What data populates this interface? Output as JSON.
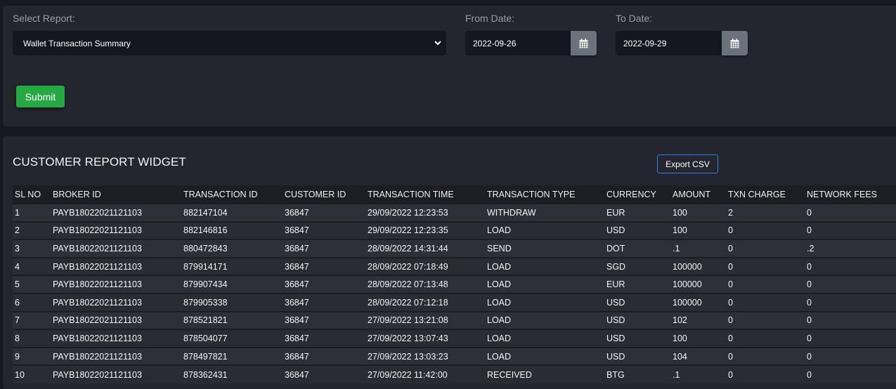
{
  "filters": {
    "select_report_label": "Select Report:",
    "select_report_value": "Wallet Transaction Summary",
    "from_date_label": "From Date:",
    "from_date_value": "2022-09-26",
    "to_date_label": "To Date:",
    "to_date_value": "2022-09-29",
    "submit_label": "Submit"
  },
  "widget": {
    "title": "CUSTOMER REPORT WIDGET",
    "export_label": "Export CSV",
    "columns": [
      "SL NO",
      "BROKER ID",
      "TRANSACTION ID",
      "CUSTOMER ID",
      "TRANSACTION TIME",
      "TRANSACTION TYPE",
      "CURRENCY",
      "AMOUNT",
      "TXN CHARGE",
      "NETWORK FEES"
    ],
    "rows": [
      [
        "1",
        "PAYB18022021121103",
        "882147104",
        "36847",
        "29/09/2022 12:23:53",
        "WITHDRAW",
        "EUR",
        "100",
        "2",
        "0"
      ],
      [
        "2",
        "PAYB18022021121103",
        "882146816",
        "36847",
        "29/09/2022 12:23:35",
        "LOAD",
        "USD",
        "100",
        "0",
        "0"
      ],
      [
        "3",
        "PAYB18022021121103",
        "880472843",
        "36847",
        "28/09/2022 14:31:44",
        "SEND",
        "DOT",
        ".1",
        "0",
        ".2"
      ],
      [
        "4",
        "PAYB18022021121103",
        "879914171",
        "36847",
        "28/09/2022 07:18:49",
        "LOAD",
        "SGD",
        "100000",
        "0",
        "0"
      ],
      [
        "5",
        "PAYB18022021121103",
        "879907434",
        "36847",
        "28/09/2022 07:13:48",
        "LOAD",
        "EUR",
        "100000",
        "0",
        "0"
      ],
      [
        "6",
        "PAYB18022021121103",
        "879905338",
        "36847",
        "28/09/2022 07:12:18",
        "LOAD",
        "USD",
        "100000",
        "0",
        "0"
      ],
      [
        "7",
        "PAYB18022021121103",
        "878521821",
        "36847",
        "27/09/2022 13:21:08",
        "LOAD",
        "USD",
        "102",
        "0",
        "0"
      ],
      [
        "8",
        "PAYB18022021121103",
        "878504077",
        "36847",
        "27/09/2022 13:07:43",
        "LOAD",
        "USD",
        "100",
        "0",
        "0"
      ],
      [
        "9",
        "PAYB18022021121103",
        "878497821",
        "36847",
        "27/09/2022 13:03:23",
        "LOAD",
        "USD",
        "104",
        "0",
        "0"
      ],
      [
        "10",
        "PAYB18022021121103",
        "878362431",
        "36847",
        "27/09/2022 11:42:00",
        "RECEIVED",
        "BTG",
        ".1",
        "0",
        "0"
      ]
    ]
  },
  "icons": {
    "select_chevron": "chevron-down-icon",
    "date_picker": "calendar-icon"
  },
  "colors": {
    "submit": "#28a745",
    "export_border": "#2f7be0",
    "page_bg": "#151922",
    "card_bg": "#24262f"
  }
}
